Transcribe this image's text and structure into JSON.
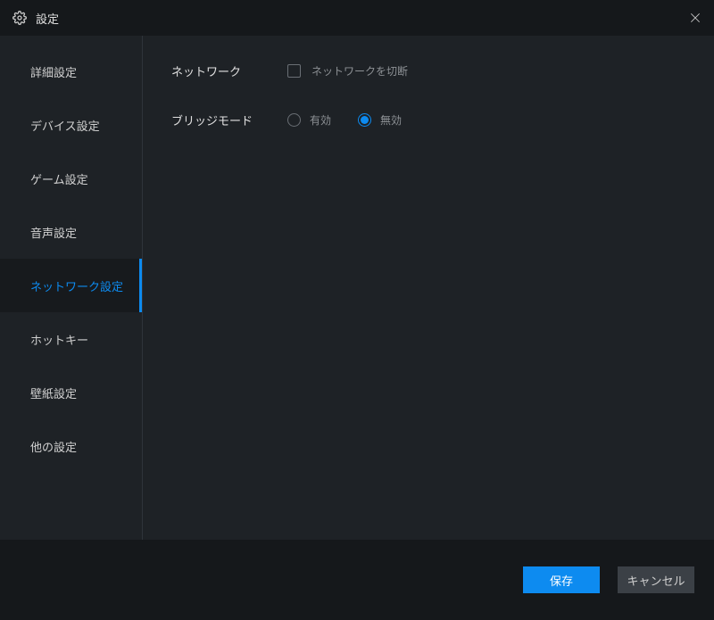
{
  "window": {
    "title": "設定"
  },
  "sidebar": {
    "items": [
      {
        "label": "詳細設定",
        "active": false
      },
      {
        "label": "デバイス設定",
        "active": false
      },
      {
        "label": "ゲーム設定",
        "active": false
      },
      {
        "label": "音声設定",
        "active": false
      },
      {
        "label": "ネットワーク設定",
        "active": true
      },
      {
        "label": "ホットキー",
        "active": false
      },
      {
        "label": "壁紙設定",
        "active": false
      },
      {
        "label": "他の設定",
        "active": false
      }
    ]
  },
  "network": {
    "section_label": "ネットワーク",
    "disconnect_checkbox_label": "ネットワークを切断",
    "disconnect_checked": false
  },
  "bridge": {
    "section_label": "ブリッジモード",
    "options": [
      {
        "label": "有効",
        "checked": false
      },
      {
        "label": "無効",
        "checked": true
      }
    ]
  },
  "footer": {
    "save_label": "保存",
    "cancel_label": "キャンセル"
  },
  "colors": {
    "accent": "#0d8bf0",
    "bg": "#1e2226",
    "bg_dark": "#15181b"
  }
}
